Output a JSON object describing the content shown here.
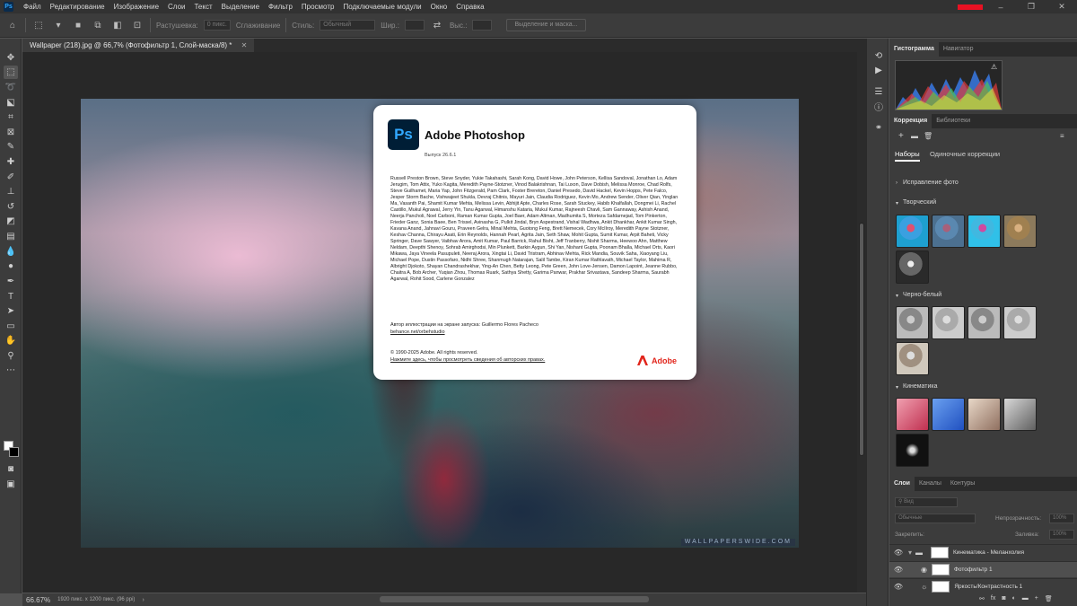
{
  "menu": [
    "Файл",
    "Редактирование",
    "Изображение",
    "Слои",
    "Текст",
    "Выделение",
    "Фильтр",
    "Просмотр",
    "Подключаемые модули",
    "Окно",
    "Справка"
  ],
  "options_bar": {
    "feather_label": "Растушевка:",
    "feather_value": "0 пикс.",
    "antialias_label": "Сглаживание",
    "style_label": "Стиль:",
    "style_value": "Обычный",
    "width_label": "Шир.:",
    "height_label": "Выс.:",
    "select_mask_button": "Выделение и маска..."
  },
  "document_tab": "Wallpaper (218).jpg @ 66,7% (Фотофильтр 1, Слой-маска/8) *",
  "canvas": {
    "watermark": "WALLPAPERSWIDE.COM"
  },
  "splash": {
    "logo": "Ps",
    "title": "Adobe Photoshop",
    "version": "Выпуск 26.6.1",
    "credits": "Russell Preston Brown, Steve Snyder, Yukie Takahashi, Sarah Kong, David Howe, John Peterson, Kellisa Sandoval, Jonathan Lo, Adam Jerugim, Tom Attix, Yuko Kagita, Meredith Payne-Stotzner, Vinod Balakrishnan, Tai Luxon, Dave Dobish, Melissa Monroe, Chad Rolfs, Steve Guilhamet, Maria Yap, John Fitzgerald, Pam Clark, Foster Brereton, Daniel Presedo, David Hackel, Kevin Hopps, Pete Falco, Jesper Storm Bache, Vishwajeet Shukla, Devraj Chitnis, Mayuri Jain, Claudia Rodriguez, Kevin Mo, Andrew Sender, Oliver Qian, Yinglan Ma, Vasanth Pai, Shamit Kumar Mehta, Melissa Levin, Abhijit Apte, Charles Rose, Sarah Stuckey, Habib Khalfallah, Dongmei Li, Rachel Castillo, Mukul Agrawal, Jerry Yin, Tanu Agarwal, Himanshu Kataria, Mukul Kumar, Rajneesh Chavli, Sam Gannaway, Ashish Anand, Neerja Pancholi, Noel Carboni, Raman Kumar Gupta, Joel Baer, Adam Altman, Madhumita S, Morteza Safdarnejad, Tom Pinkerton, Frieder Ganz, Sonia Baee, Ben Trissel, Avinasha G, Pulkit Jindal, Bryn Aspestrand, Vishal Wadhwa, Ankit Dhankhar, Ankit Kumar Singh, Kavana Anand, Jahnavi Gouru, Praveen Gelra, Minal Mehta, Guotong Feng, Brett Nemecek, Cory McIlroy, Meredith Payne Stotzner, Keshav Channa, Chirayu Asati, Erin Reynolds, Hannah Pearl, Agrita Jain, Seth Shaw, Mohit Gupta, Sumit Kumar, Arpit Baheti, Vicky Springer, Dave Sawyer, Vaibhav Arora, Amit Kumar, Paul Barrick, Rahul Bisht, Jeff Tranberry, Nishit Sharma, Heewoo Ahn, Matthew Neldam, Deepthi Shenoy, Sohrab Amirghodsi, Min Plunkett, Barkin Aygun, Shi Yan, Nishant Gupta, Poonam Bhalla, Michael Orts, Kaori Mikawa, Jaya Vineela Pasupuleti, Neeraj Arora, Xingtai Li, David Tristram, Abhinav Mehta, Rick Mandia, Souvik Saha, Xiaoyang Liu, Michael Pope, Dustin Passofaro, Nidhi Shree, Shanmugh Natarajan, Salil Tambe, Kiran Kumar Rathlavath, Michael Taylor, Mahima R, Albright Djokoto, Shayan Chandrashekhar, Ying-An Chen, Betty Leong, Pete Green, John Love-Jensen, Damon Lapoint, Jeanne Rubbo, Chaitra A, Bob Archer, Yuqian Zhou, Thomas Ruark, Sathya Shetty, Garima Panwar, Prakhar Srivastava, Sandeep Sharma, Saurabh Agarwal, Rohit Sood, Carlene Gonzalez",
    "illustration_credit": "Автор иллюстрации на экране запуска: Guillermo Flores Pacheco",
    "illustration_link": "behance.net/orbehstudio",
    "copyright": "© 1990-2025 Adobe. All rights reserved.",
    "legal_link": "Нажмите здесь, чтобы просмотреть сведения об авторских правах.",
    "brand": "Adobe"
  },
  "status": {
    "zoom": "66.67%",
    "doc_info": "1920 пикс. x 1200 пикс. (96 ppi)"
  },
  "panels": {
    "top_tabs": [
      "Гистограмма",
      "Навигатор"
    ],
    "adjust_tabs": [
      "Коррекция",
      "Библиотеки"
    ],
    "subtabs": [
      "Наборы",
      "Одиночные коррекции"
    ],
    "sections": {
      "photo_fix": "Исправление фото",
      "creative": "Творческий",
      "bw": "Черно-белый",
      "cinematic": "Кинематика"
    },
    "layers_tabs": [
      "Слои",
      "Каналы",
      "Контуры"
    ],
    "layer_search": "Вид",
    "blend_mode": "Обычные",
    "opacity_label": "Непрозрачность:",
    "opacity_value": "100%",
    "lock_label": "Закрепить:",
    "fill_label": "Заливка:",
    "fill_value": "100%",
    "layers": [
      {
        "name": "Кинематика - Меланхолия"
      },
      {
        "name": "Фотофильтр 1"
      },
      {
        "name": "Яркость/Контрастность 1"
      }
    ]
  },
  "colors": {
    "accent": "#31a8ff",
    "adobe_red": "#e1251b",
    "ui_bg": "#535353",
    "panel_bg": "#3c3c3c"
  }
}
